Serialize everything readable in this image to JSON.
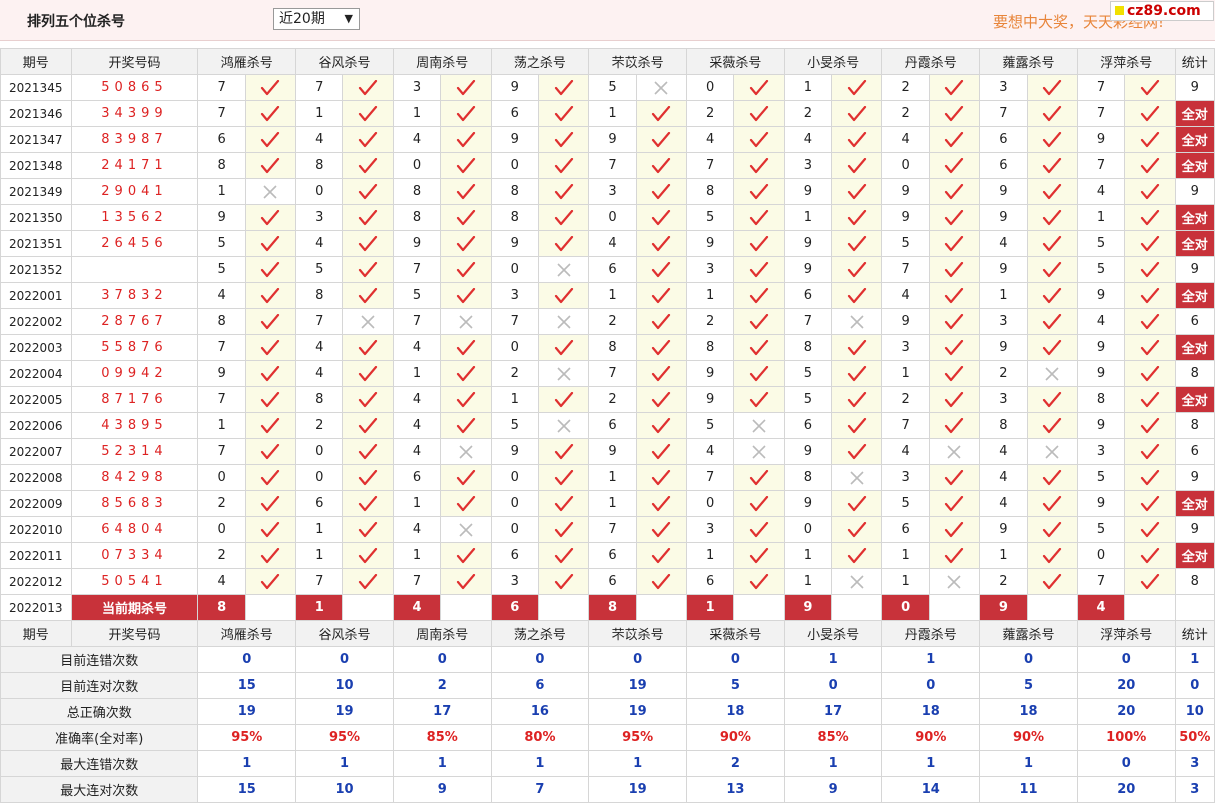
{
  "header": {
    "title": "排列五个位杀号",
    "range_select": "近20期",
    "slogan": "要想中大奖，天天彩经网!",
    "logo": "cz89.com"
  },
  "columns": {
    "period": "期号",
    "draw": "开奖号码",
    "experts": [
      "鸿雁杀号",
      "谷风杀号",
      "周南杀号",
      "荡之杀号",
      "芣苡杀号",
      "采薇杀号",
      "小旻杀号",
      "丹霞杀号",
      "蕹露杀号",
      "浮萍杀号"
    ],
    "stat": "统计"
  },
  "rows": [
    {
      "period": "2021345",
      "draw": "50865",
      "nums": [
        7,
        7,
        3,
        9,
        5,
        0,
        1,
        2,
        3,
        7
      ],
      "ok": [
        1,
        1,
        1,
        1,
        0,
        1,
        1,
        1,
        1,
        1
      ],
      "stat": "9"
    },
    {
      "period": "2021346",
      "draw": "34399",
      "nums": [
        7,
        1,
        1,
        6,
        1,
        2,
        2,
        2,
        7,
        7
      ],
      "ok": [
        1,
        1,
        1,
        1,
        1,
        1,
        1,
        1,
        1,
        1
      ],
      "stat": "全对"
    },
    {
      "period": "2021347",
      "draw": "83987",
      "nums": [
        6,
        4,
        4,
        9,
        9,
        4,
        4,
        4,
        6,
        9
      ],
      "ok": [
        1,
        1,
        1,
        1,
        1,
        1,
        1,
        1,
        1,
        1
      ],
      "stat": "全对"
    },
    {
      "period": "2021348",
      "draw": "24171",
      "nums": [
        8,
        8,
        0,
        0,
        7,
        7,
        3,
        0,
        6,
        7
      ],
      "ok": [
        1,
        1,
        1,
        1,
        1,
        1,
        1,
        1,
        1,
        1
      ],
      "stat": "全对"
    },
    {
      "period": "2021349",
      "draw": "29041",
      "nums": [
        1,
        0,
        8,
        8,
        3,
        8,
        9,
        9,
        9,
        4
      ],
      "ok": [
        0,
        1,
        1,
        1,
        1,
        1,
        1,
        1,
        1,
        1
      ],
      "stat": "9"
    },
    {
      "period": "2021350",
      "draw": "13562",
      "nums": [
        9,
        3,
        8,
        8,
        0,
        5,
        1,
        9,
        9,
        1
      ],
      "ok": [
        1,
        1,
        1,
        1,
        1,
        1,
        1,
        1,
        1,
        1
      ],
      "stat": "全对"
    },
    {
      "period": "2021351",
      "draw": "26456",
      "nums": [
        5,
        4,
        9,
        9,
        4,
        9,
        9,
        5,
        4,
        5
      ],
      "ok": [
        1,
        1,
        1,
        1,
        1,
        1,
        1,
        1,
        1,
        1
      ],
      "stat": "全对"
    },
    {
      "period": "2021352",
      "draw": "",
      "nums": [
        5,
        5,
        7,
        0,
        6,
        3,
        9,
        7,
        9,
        5
      ],
      "ok": [
        1,
        1,
        1,
        0,
        1,
        1,
        1,
        1,
        1,
        1
      ],
      "stat": "9"
    },
    {
      "period": "2022001",
      "draw": "37832",
      "nums": [
        4,
        8,
        5,
        3,
        1,
        1,
        6,
        4,
        1,
        9
      ],
      "ok": [
        1,
        1,
        1,
        1,
        1,
        1,
        1,
        1,
        1,
        1
      ],
      "stat": "全对"
    },
    {
      "period": "2022002",
      "draw": "28767",
      "nums": [
        8,
        7,
        7,
        7,
        2,
        2,
        7,
        9,
        3,
        4
      ],
      "ok": [
        1,
        0,
        0,
        0,
        1,
        1,
        0,
        1,
        1,
        1
      ],
      "stat": "6"
    },
    {
      "period": "2022003",
      "draw": "55876",
      "nums": [
        7,
        4,
        4,
        0,
        8,
        8,
        8,
        3,
        9,
        9
      ],
      "ok": [
        1,
        1,
        1,
        1,
        1,
        1,
        1,
        1,
        1,
        1
      ],
      "stat": "全对"
    },
    {
      "period": "2022004",
      "draw": "09942",
      "nums": [
        9,
        4,
        1,
        2,
        7,
        9,
        5,
        1,
        2,
        9
      ],
      "ok": [
        1,
        1,
        1,
        0,
        1,
        1,
        1,
        1,
        0,
        1
      ],
      "stat": "8"
    },
    {
      "period": "2022005",
      "draw": "87176",
      "nums": [
        7,
        8,
        4,
        1,
        2,
        9,
        5,
        2,
        3,
        8
      ],
      "ok": [
        1,
        1,
        1,
        1,
        1,
        1,
        1,
        1,
        1,
        1
      ],
      "stat": "全对"
    },
    {
      "period": "2022006",
      "draw": "43895",
      "nums": [
        1,
        2,
        4,
        5,
        6,
        5,
        6,
        7,
        8,
        9
      ],
      "ok": [
        1,
        1,
        1,
        0,
        1,
        0,
        1,
        1,
        1,
        1
      ],
      "stat": "8"
    },
    {
      "period": "2022007",
      "draw": "52314",
      "nums": [
        7,
        0,
        4,
        9,
        9,
        4,
        9,
        4,
        4,
        3
      ],
      "ok": [
        1,
        1,
        0,
        1,
        1,
        0,
        1,
        0,
        0,
        1
      ],
      "stat": "6"
    },
    {
      "period": "2022008",
      "draw": "84298",
      "nums": [
        0,
        0,
        6,
        0,
        1,
        7,
        8,
        3,
        4,
        5
      ],
      "ok": [
        1,
        1,
        1,
        1,
        1,
        1,
        0,
        1,
        1,
        1
      ],
      "stat": "9"
    },
    {
      "period": "2022009",
      "draw": "85683",
      "nums": [
        2,
        6,
        1,
        0,
        1,
        0,
        9,
        5,
        4,
        9
      ],
      "ok": [
        1,
        1,
        1,
        1,
        1,
        1,
        1,
        1,
        1,
        1
      ],
      "stat": "全对"
    },
    {
      "period": "2022010",
      "draw": "64804",
      "nums": [
        0,
        1,
        4,
        0,
        7,
        3,
        0,
        6,
        9,
        5
      ],
      "ok": [
        1,
        1,
        0,
        1,
        1,
        1,
        1,
        1,
        1,
        1
      ],
      "stat": "9"
    },
    {
      "period": "2022011",
      "draw": "07334",
      "nums": [
        2,
        1,
        1,
        6,
        6,
        1,
        1,
        1,
        1,
        0
      ],
      "ok": [
        1,
        1,
        1,
        1,
        1,
        1,
        1,
        1,
        1,
        1
      ],
      "stat": "全对"
    },
    {
      "period": "2022012",
      "draw": "50541",
      "nums": [
        4,
        7,
        7,
        3,
        6,
        6,
        1,
        1,
        2,
        7
      ],
      "ok": [
        1,
        1,
        1,
        1,
        1,
        1,
        0,
        0,
        1,
        1
      ],
      "stat": "8"
    }
  ],
  "current": {
    "period": "2022013",
    "label": "当前期杀号",
    "nums": [
      "8",
      "1",
      "4",
      "6",
      "8",
      "1",
      "9",
      "0",
      "9",
      "4"
    ]
  },
  "stats": [
    {
      "label": "目前连错次数",
      "values": [
        "0",
        "0",
        "0",
        "0",
        "0",
        "0",
        "1",
        "1",
        "0",
        "0"
      ],
      "stat": "1",
      "red": false
    },
    {
      "label": "目前连对次数",
      "values": [
        "15",
        "10",
        "2",
        "6",
        "19",
        "5",
        "0",
        "0",
        "5",
        "20"
      ],
      "stat": "0",
      "red": false
    },
    {
      "label": "总正确次数",
      "values": [
        "19",
        "19",
        "17",
        "16",
        "19",
        "18",
        "17",
        "18",
        "18",
        "20"
      ],
      "stat": "10",
      "red": false
    },
    {
      "label": "准确率(全对率)",
      "values": [
        "95%",
        "95%",
        "85%",
        "80%",
        "95%",
        "90%",
        "85%",
        "90%",
        "90%",
        "100%"
      ],
      "stat": "50%",
      "red": true
    },
    {
      "label": "最大连错次数",
      "values": [
        "1",
        "1",
        "1",
        "1",
        "1",
        "2",
        "1",
        "1",
        "1",
        "0"
      ],
      "stat": "3",
      "red": false
    },
    {
      "label": "最大连对次数",
      "values": [
        "15",
        "10",
        "9",
        "7",
        "19",
        "13",
        "9",
        "14",
        "11",
        "20"
      ],
      "stat": "3",
      "red": false
    }
  ],
  "colors": {
    "check": "#e03030",
    "cross": "#bbbbbb",
    "accent": "#c8323a",
    "stat_blue": "#1a3fb0"
  }
}
